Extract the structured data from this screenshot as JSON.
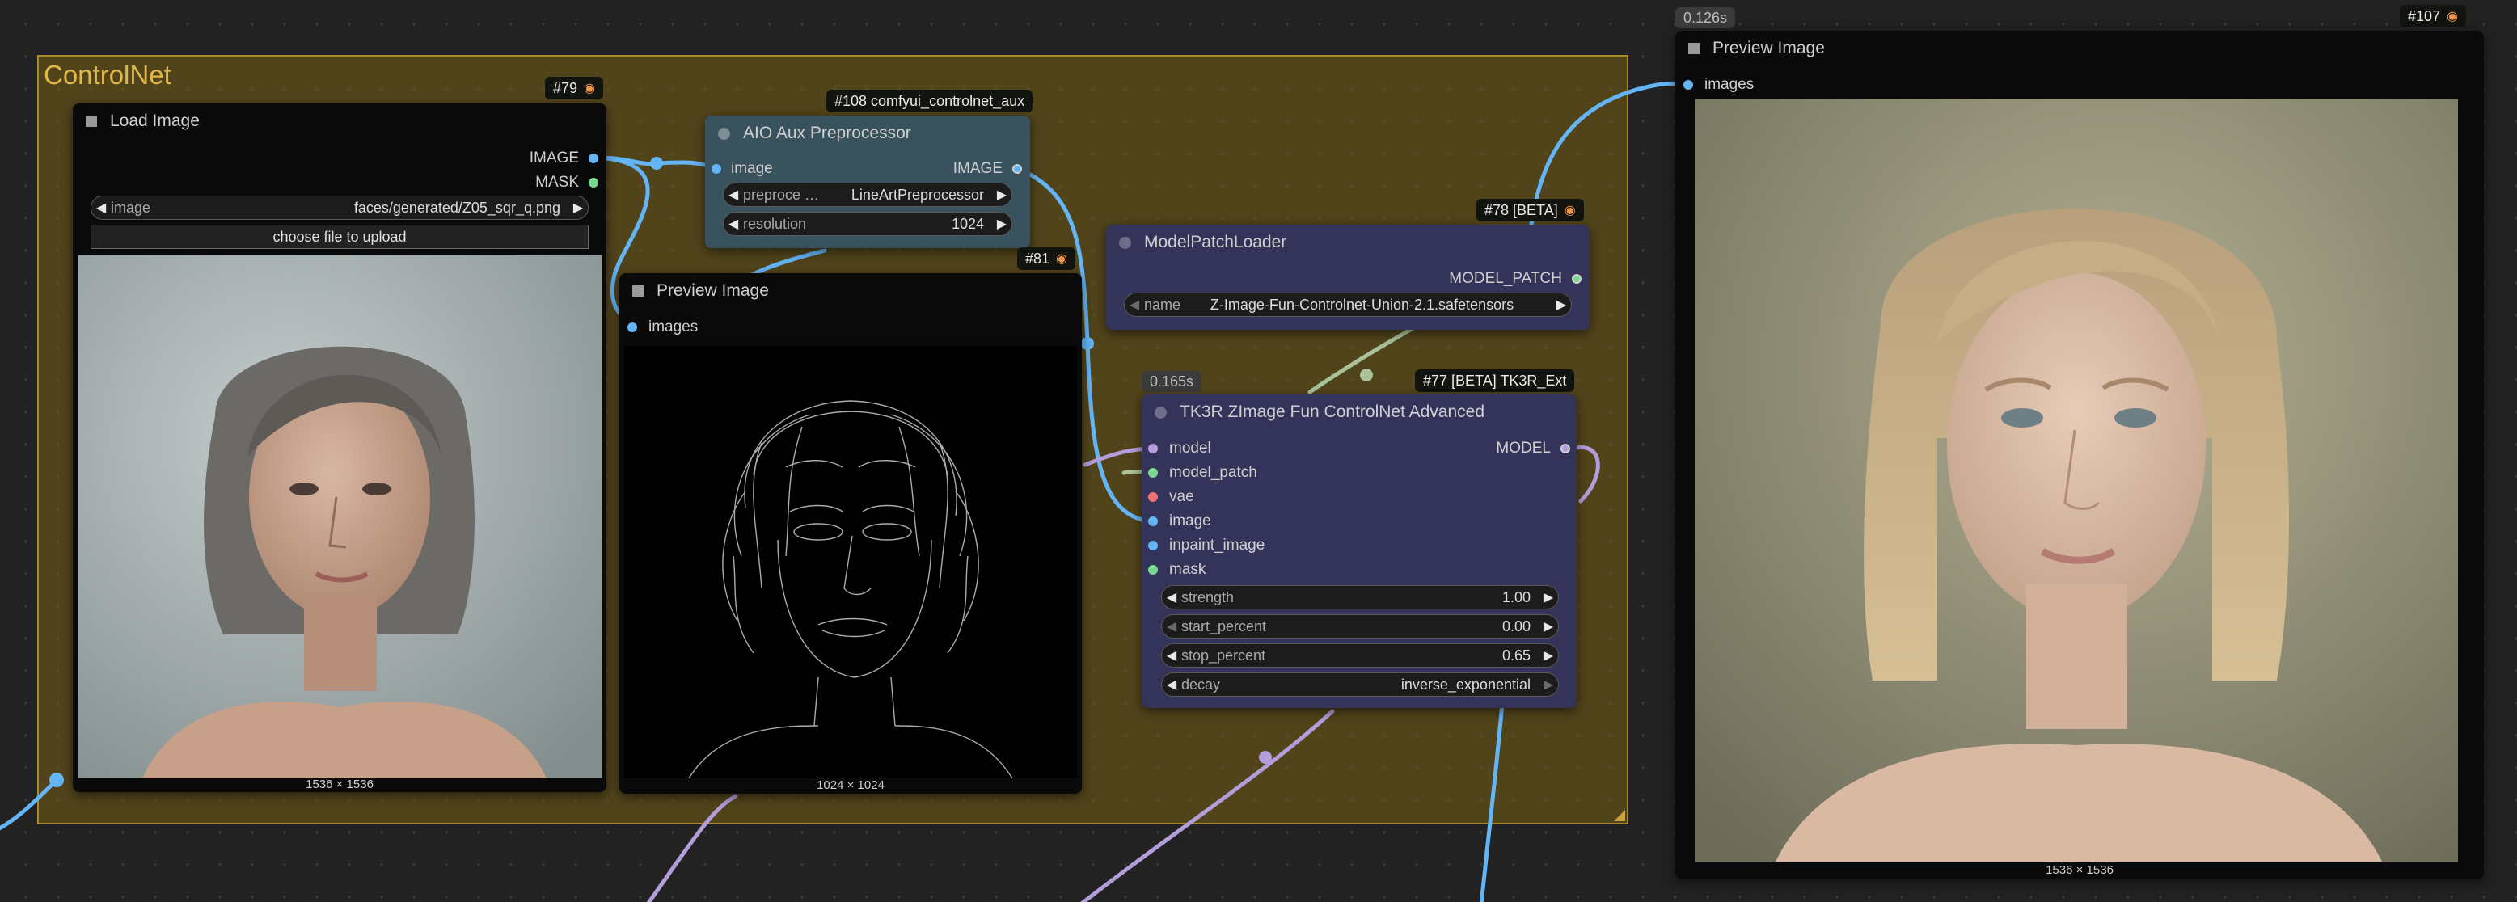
{
  "group": {
    "title": "ControlNet"
  },
  "load_image": {
    "badge": "#79",
    "title": "Load Image",
    "outputs": [
      "IMAGE",
      "MASK"
    ],
    "image_widget": {
      "label": "image",
      "value": "faces/generated/Z05_sqr_q.png"
    },
    "upload_label": "choose file to upload",
    "dims": "1536 × 1536"
  },
  "aio_preprocessor": {
    "badge": "#108 comfyui_controlnet_aux",
    "title": "AIO Aux Preprocessor",
    "input": "image",
    "output": "IMAGE",
    "preprocessor_widget": {
      "label": "preproce …",
      "value": "LineArtPreprocessor"
    },
    "resolution_widget": {
      "label": "resolution",
      "value": "1024"
    }
  },
  "preview_mid": {
    "badge": "#81",
    "title": "Preview Image",
    "input": "images",
    "dims": "1024 × 1024"
  },
  "model_patch_loader": {
    "badge": "#78 [BETA]",
    "title": "ModelPatchLoader",
    "output": "MODEL_PATCH",
    "name_widget": {
      "label": "name",
      "value": "Z-Image-Fun-Controlnet-Union-2.1.safetensors"
    }
  },
  "tk3r": {
    "timing": "0.165s",
    "badge": "#77 [BETA] TK3R_Ext",
    "title": "TK3R ZImage Fun ControlNet Advanced",
    "inputs": [
      "model",
      "model_patch",
      "vae",
      "image",
      "inpaint_image",
      "mask"
    ],
    "output": "MODEL",
    "widgets": [
      {
        "label": "strength",
        "value": "1.00"
      },
      {
        "label": "start_percent",
        "value": "0.00"
      },
      {
        "label": "stop_percent",
        "value": "0.65"
      },
      {
        "label": "decay",
        "value": "inverse_exponential"
      }
    ]
  },
  "preview_right": {
    "timing": "0.126s",
    "badge": "#107",
    "title": "Preview Image",
    "input": "images",
    "dims": "1536 × 1536"
  },
  "colors": {
    "image_link": "#64b5f6",
    "model_link": "#b39ddb",
    "patch_link": "#a9c29a",
    "group_title": "#e0b84a",
    "node_dark": "#0a0a0a",
    "node_blue_gray": "#38525e",
    "node_indigo": "#34335a"
  },
  "icons": {
    "node_badge": "fox-icon",
    "collapse": "square-icon"
  }
}
